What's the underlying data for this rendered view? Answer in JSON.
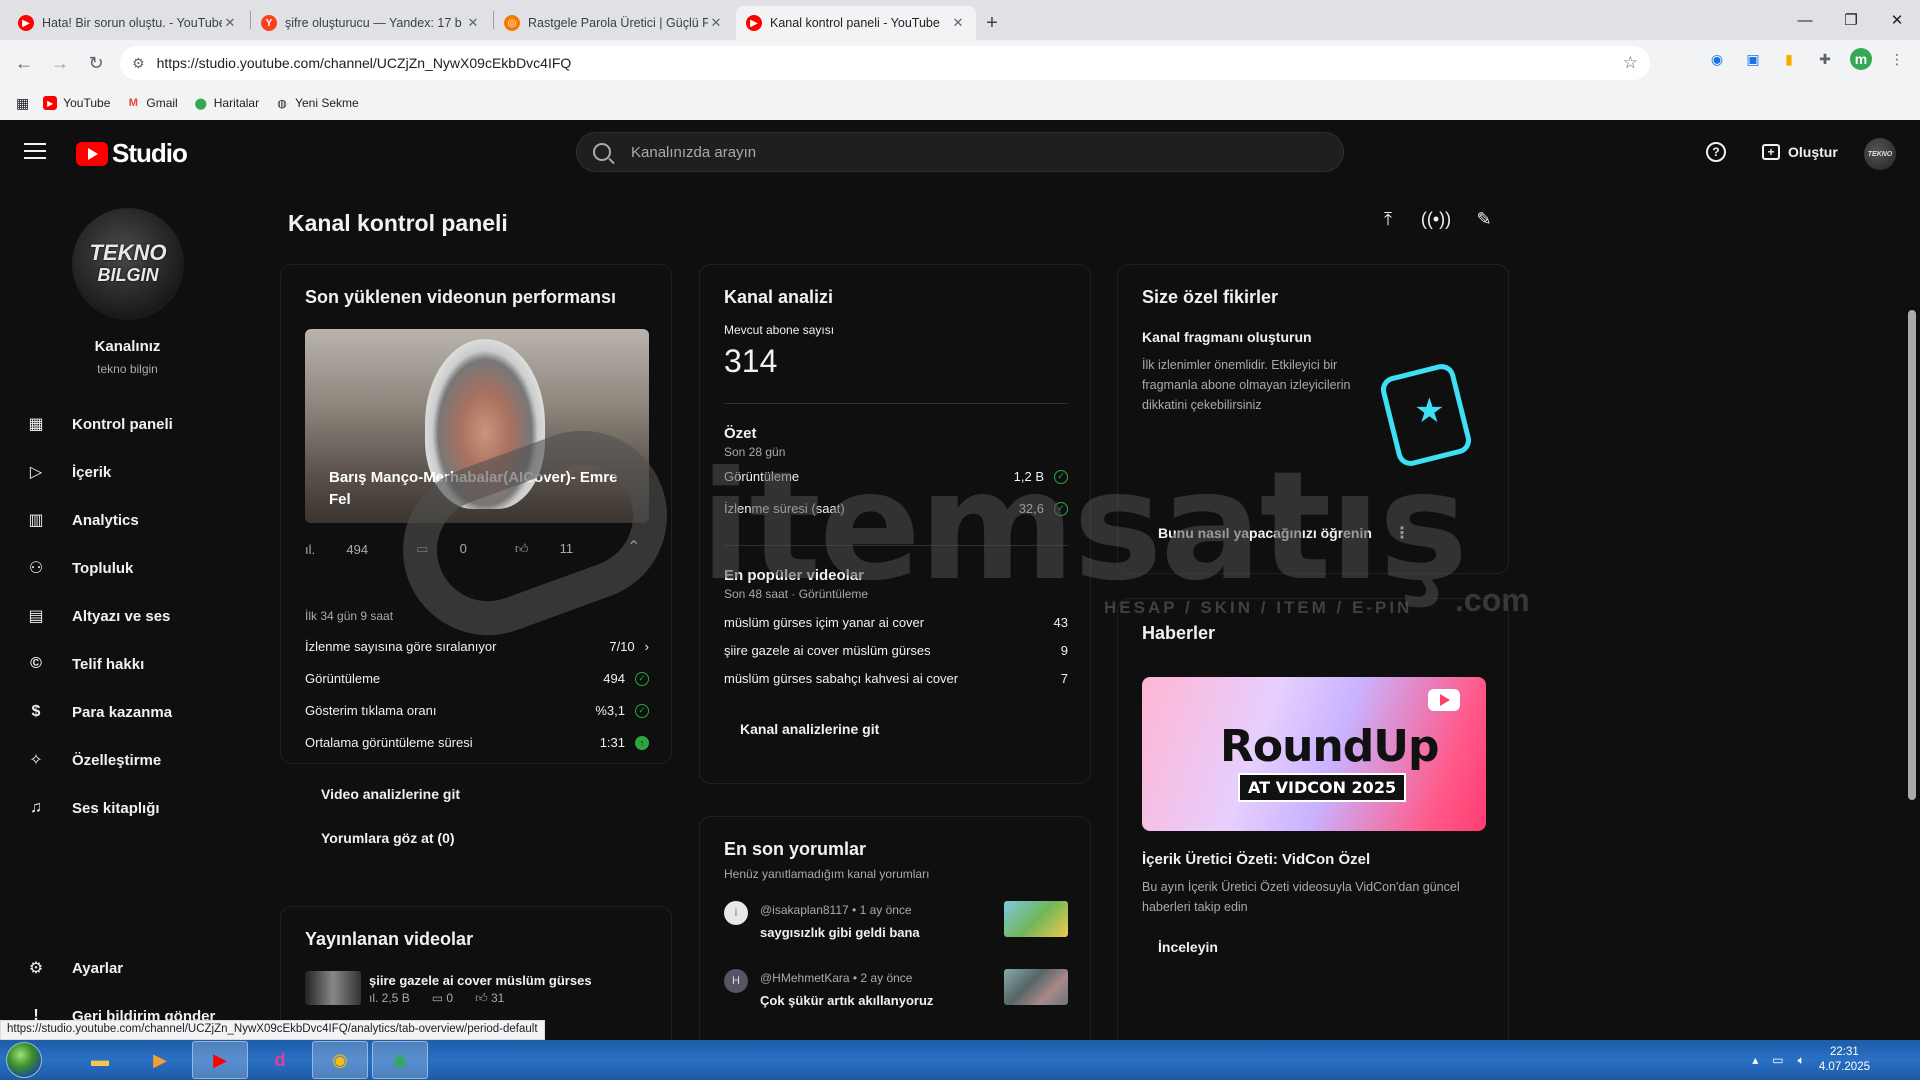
{
  "browser": {
    "tabs": [
      {
        "title": "Hata! Bir sorun oluştu. - YouTube",
        "icon": "youtube-icon",
        "color": "#ff0000"
      },
      {
        "title": "şifre oluşturucu — Yandex: 17 b",
        "icon": "yandex-icon",
        "color": "#fc3f1d"
      },
      {
        "title": "Rastgele Parola Üretici | Güçlü P",
        "icon": "generator-icon",
        "color": "#f57c00"
      },
      {
        "title": "Kanal kontrol paneli - YouTube",
        "icon": "youtube-icon",
        "color": "#ff0000"
      }
    ],
    "url": "https://studio.youtube.com/channel/UCZjZn_NywX09cEkbDvc4IFQ",
    "bookmarks": [
      {
        "label": "YouTube",
        "icon": "youtube-icon"
      },
      {
        "label": "Gmail",
        "icon": "gmail-icon"
      },
      {
        "label": "Haritalar",
        "icon": "maps-icon"
      },
      {
        "label": "Yeni Sekme",
        "icon": "globe-icon"
      }
    ],
    "profile_letter": "m",
    "hover_url": "https://studio.youtube.com/channel/UCZjZn_NywX09cEkbDvc4IFQ/analytics/tab-overview/period-default"
  },
  "studio": {
    "logo_text": "Studio",
    "search_placeholder": "Kanalınızda arayın",
    "create_label": "Oluştur",
    "avatar_text": "TEKNO"
  },
  "sidebar": {
    "channel_logo_line1": "TEKNO",
    "channel_logo_line2": "BILGIN",
    "channel_title": "Kanalınız",
    "channel_handle": "tekno bilgin",
    "items": [
      {
        "label": "Kontrol paneli",
        "icon": "dashboard-icon"
      },
      {
        "label": "İçerik",
        "icon": "content-icon"
      },
      {
        "label": "Analytics",
        "icon": "analytics-icon"
      },
      {
        "label": "Topluluk",
        "icon": "community-icon"
      },
      {
        "label": "Altyazı ve ses",
        "icon": "subtitles-icon"
      },
      {
        "label": "Telif hakkı",
        "icon": "copyright-icon"
      },
      {
        "label": "Para kazanma",
        "icon": "dollar-icon"
      },
      {
        "label": "Özelleştirme",
        "icon": "magic-wand-icon"
      },
      {
        "label": "Ses kitaplığı",
        "icon": "audio-library-icon"
      }
    ],
    "bottom": [
      {
        "label": "Ayarlar",
        "icon": "settings-icon"
      },
      {
        "label": "Geri bildirim gönder",
        "icon": "feedback-icon"
      }
    ]
  },
  "page": {
    "title": "Kanal kontrol paneli"
  },
  "latest_video": {
    "title": "Son yüklenen videonun performansı",
    "video_title": "Barış Mançо-Merhabalar(AICover)- Emre Fel",
    "views": "494",
    "comments": "0",
    "likes": "11",
    "period": "İlk 34 gün 9 saat",
    "rows": [
      {
        "label": "İzlenme sayısına göre sıralanıyor",
        "value": "7/10",
        "status": "chevron"
      },
      {
        "label": "Görüntüleme",
        "value": "494",
        "status": "check"
      },
      {
        "label": "Gösterim tıklama oranı",
        "value": "%3,1",
        "status": "check"
      },
      {
        "label": "Ortalama görüntüleme süresi",
        "value": "1:31",
        "status": "up"
      }
    ],
    "link1": "Video analizlerine git",
    "link2": "Yorumlara göz at (0)"
  },
  "published": {
    "title": "Yayınlanan videolar",
    "video_title": "şiire gazele ai cover müslüm gürses",
    "views": "2,5 B",
    "comments": "0",
    "likes": "31"
  },
  "analytics": {
    "title": "Kanal analizi",
    "subs_label": "Mevcut abone sayısı",
    "subs_value": "314",
    "summary_title": "Özet",
    "summary_period": "Son 28 gün",
    "summary_rows": [
      {
        "label": "Görüntüleme",
        "value": "1,2 B"
      },
      {
        "label": "İzlenme süresi (saat)",
        "value": "32,6"
      }
    ],
    "top_title": "En popüler videolar",
    "top_period": "Son 48 saat · Görüntüleme",
    "top_videos": [
      {
        "title": "müslüm gürses içim yanar ai cover",
        "value": "43"
      },
      {
        "title": "şiire gazele ai cover müslüm gürses",
        "value": "9"
      },
      {
        "title": "müslüm gürses sabahçı kahvesi ai cover",
        "value": "7"
      }
    ],
    "link": "Kanal analizlerine git"
  },
  "comments": {
    "title": "En son yorumlar",
    "subtitle": "Henüz yanıtlamadığım kanal yorumları",
    "items": [
      {
        "avatar": "i",
        "author": "@isakaplan8117",
        "time": "1 ay önce",
        "text": "saygısızlık gibi geldi bana"
      },
      {
        "avatar": "H",
        "author": "@HMehmetKara",
        "time": "2 ay önce",
        "text": "Çok şükür artık akıllanyoruz"
      }
    ]
  },
  "ideas": {
    "title": "Size özel fikirler",
    "heading": "Kanal fragmanı oluşturun",
    "body": "İlk izlenimler önemlidir. Etkileyici bir fragmanla abone olmayan izleyicilerin dikkatini çekebilirsiniz",
    "link": "Bunu nasıl yapacağınızı öğrenin"
  },
  "news": {
    "title": "Haberler",
    "banner_title": "RoundUp",
    "banner_sub": "AT VIDCON 2025",
    "headline": "İçerik Üretici Özeti: VidCon Özel",
    "body": "Bu ayın İçerik Üretici Özeti videosuyla VidCon'dan güncel haberleri takip edin",
    "link": "İnceleyin"
  },
  "watermark": {
    "text": "itemsatış",
    "tagline": "HESAP / SKIN / ITEM / E-PIN",
    "suffix": ".com"
  },
  "taskbar": {
    "time": "22:31",
    "date": "4.07.2025"
  }
}
